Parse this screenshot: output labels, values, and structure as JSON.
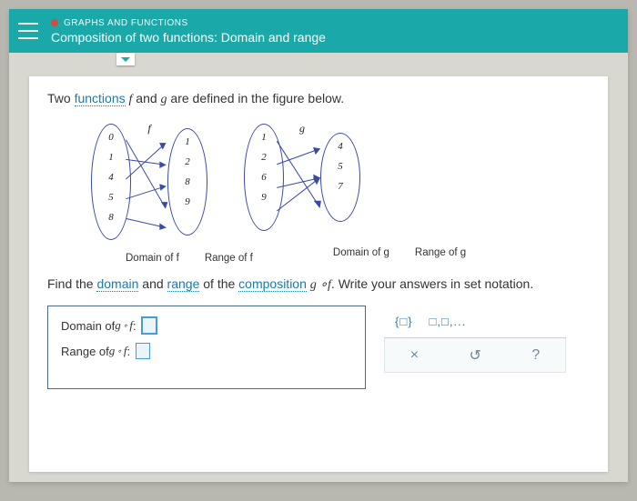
{
  "header": {
    "category": "GRAPHS AND FUNCTIONS",
    "title": "Composition of two functions: Domain and range"
  },
  "intro": {
    "prefix": "Two ",
    "link": "functions",
    "mid": " ",
    "f": "f",
    "and": " and ",
    "g": "g",
    "suffix": " are defined in the figure below."
  },
  "diagram": {
    "f": {
      "label": "f",
      "domain": [
        "0",
        "1",
        "4",
        "5",
        "8"
      ],
      "range": [
        "1",
        "2",
        "8",
        "9"
      ],
      "cap_domain": "Domain of  f",
      "cap_range": "Range of  f"
    },
    "g": {
      "label": "g",
      "domain": [
        "1",
        "2",
        "6",
        "9"
      ],
      "range": [
        "4",
        "5",
        "7"
      ],
      "cap_domain": "Domain of  g",
      "cap_range": "Range of  g"
    }
  },
  "prompt": {
    "p1": "Find the ",
    "domain": "domain",
    "p2": " and ",
    "range": "range",
    "p3": " of the ",
    "comp": "composition",
    "p4": " ",
    "g": "g",
    "circ": " ∘",
    "f": "f",
    "p5": ". Write your answers in set notation."
  },
  "answers": {
    "line1_label_pre": "Domain of  ",
    "line2_label_pre": "Range of  ",
    "g": "g",
    "f": "f",
    "circ": " ∘",
    "colon": " : "
  },
  "toolbox": {
    "braces": "{□}",
    "list": "□,□,...",
    "close": "×",
    "reset": "↺",
    "help": "?"
  }
}
